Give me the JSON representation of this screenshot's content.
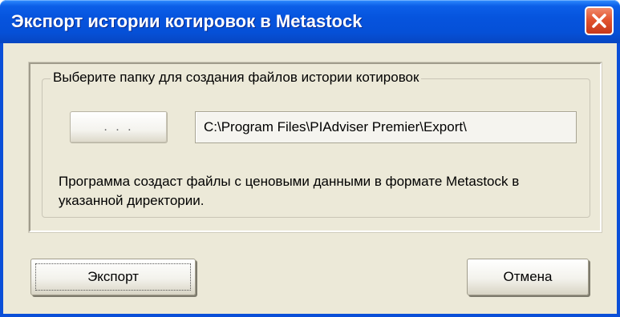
{
  "window": {
    "title": "Экспорт истории котировок в Metastock",
    "close_icon": "close-icon"
  },
  "group": {
    "legend": "Выберите папку для создания файлов истории котировок",
    "browse_label": ". . .",
    "path_value": "C:\\Program Files\\PIAdviser Premier\\Export\\",
    "description": "Программа создаст файлы с ценовыми данными в формате Metastock в указанной директории."
  },
  "buttons": {
    "export_label": "Экспорт",
    "cancel_label": "Отмена"
  },
  "colors": {
    "titlebar": "#0550d7",
    "close_button": "#e2542f",
    "dialog_background": "#ece9d8"
  }
}
